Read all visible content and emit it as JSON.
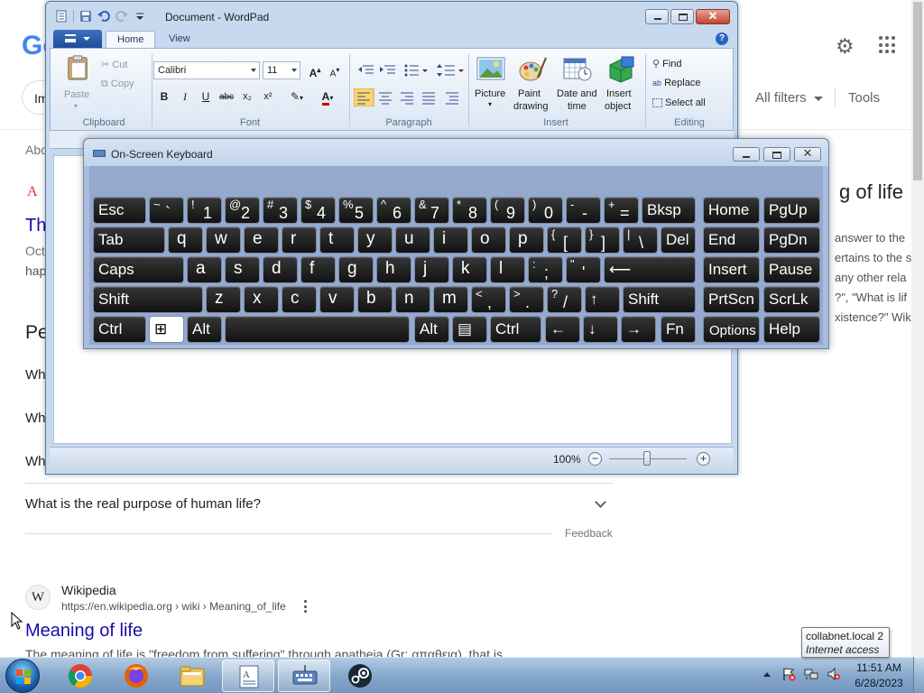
{
  "google": {
    "logo_text": "Go",
    "chip_text": "Im",
    "all_filters": "All filters",
    "tools": "Tools",
    "partial_about": "Abo",
    "partial_result_icon": "A",
    "partial_result_title": "Th",
    "partial_snippet_1": "Oct",
    "partial_snippet_2": "hap",
    "partial_people_heading": "Pe",
    "partial_q1": "Wh",
    "partial_q2": "Wh",
    "partial_q3": "Wh",
    "side_title": "g of life",
    "side_lines": [
      "answer to the",
      "ertains to the s",
      "any other rela",
      "?\", \"What is lif",
      "xistence?\" Wik"
    ],
    "faq_visible": "What is the real purpose of human life?",
    "feedback": "Feedback",
    "wiki_favicon": "W",
    "wiki_site": "Wikipedia",
    "wiki_url": "https://en.wikipedia.org › wiki › Meaning_of_life",
    "wiki_title": "Meaning of life",
    "wiki_snippet": "The meaning of life is \"freedom from suffering\" through apatheia (Gr: απαθεια), that is,"
  },
  "wordpad": {
    "title": "Document - WordPad",
    "tabs": [
      "Home",
      "View"
    ],
    "help": "?",
    "clipboard": {
      "paste": "Paste",
      "cut": "Cut",
      "copy": "Copy",
      "label": "Clipboard"
    },
    "font": {
      "family": "Calibri",
      "size": "11",
      "label": "Font",
      "bold": "B",
      "italic": "I",
      "underline": "U",
      "strike": "abc",
      "sub": "x₂",
      "sup": "x²",
      "color_letter": "A"
    },
    "paragraph": {
      "label": "Paragraph"
    },
    "insert": {
      "picture": "Picture",
      "paint_1": "Paint",
      "paint_2": "drawing",
      "date_1": "Date and",
      "date_2": "time",
      "object_1": "Insert",
      "object_2": "object",
      "label": "Insert"
    },
    "editing": {
      "find": "Find",
      "replace": "Replace",
      "select_all": "Select all",
      "label": "Editing"
    },
    "zoom": "100%"
  },
  "osk": {
    "title": "On-Screen Keyboard",
    "rows": [
      [
        {
          "label": "Esc"
        },
        {
          "sub": "~",
          "main": "`"
        },
        {
          "sub": "!",
          "main": "1"
        },
        {
          "sub": "@",
          "main": "2"
        },
        {
          "sub": "#",
          "main": "3"
        },
        {
          "sub": "$",
          "main": "4"
        },
        {
          "sub": "%",
          "main": "5"
        },
        {
          "sub": "^",
          "main": "6"
        },
        {
          "sub": "&",
          "main": "7"
        },
        {
          "sub": "*",
          "main": "8"
        },
        {
          "sub": "(",
          "main": "9"
        },
        {
          "sub": ")",
          "main": "0"
        },
        {
          "sub": "-",
          "main": "-"
        },
        {
          "sub": "+",
          "main": "="
        },
        {
          "label": "Bksp"
        },
        {
          "label": "Home"
        },
        {
          "label": "PgUp"
        }
      ],
      [
        {
          "label": "Tab"
        },
        {
          "char": "q"
        },
        {
          "char": "w"
        },
        {
          "char": "e"
        },
        {
          "char": "r"
        },
        {
          "char": "t"
        },
        {
          "char": "y"
        },
        {
          "char": "u"
        },
        {
          "char": "i"
        },
        {
          "char": "o"
        },
        {
          "char": "p"
        },
        {
          "sub": "{",
          "main": "["
        },
        {
          "sub": "}",
          "main": "]"
        },
        {
          "sub": "|",
          "main": "\\"
        },
        {
          "label": "Del"
        },
        {
          "label": "End"
        },
        {
          "label": "PgDn"
        }
      ],
      [
        {
          "label": "Caps"
        },
        {
          "char": "a"
        },
        {
          "char": "s"
        },
        {
          "char": "d"
        },
        {
          "char": "f"
        },
        {
          "char": "g"
        },
        {
          "char": "h"
        },
        {
          "char": "j"
        },
        {
          "char": "k"
        },
        {
          "char": "l"
        },
        {
          "sub": ":",
          "main": ";"
        },
        {
          "sub": "\"",
          "main": "'"
        },
        {
          "label": "⟵"
        },
        {
          "label": "Insert"
        },
        {
          "label": "Pause"
        }
      ],
      [
        {
          "label": "Shift"
        },
        {
          "char": "z"
        },
        {
          "char": "x"
        },
        {
          "char": "c"
        },
        {
          "char": "v"
        },
        {
          "char": "b"
        },
        {
          "char": "n"
        },
        {
          "char": "m"
        },
        {
          "sub": "<",
          "main": ","
        },
        {
          "sub": ">",
          "main": "."
        },
        {
          "sub": "?",
          "main": "/"
        },
        {
          "label": "↑"
        },
        {
          "label": "Shift"
        },
        {
          "label": "PrtScn"
        },
        {
          "label": "ScrLk"
        }
      ],
      [
        {
          "label": "Ctrl"
        },
        {
          "label": "⊞"
        },
        {
          "label": "Alt"
        },
        {
          "label": ""
        },
        {
          "label": "Alt"
        },
        {
          "label": "▤"
        },
        {
          "label": "Ctrl"
        },
        {
          "label": "←"
        },
        {
          "label": "↓"
        },
        {
          "label": "→"
        },
        {
          "label": "Fn"
        },
        {
          "label": "Options"
        },
        {
          "label": "Help"
        }
      ]
    ]
  },
  "taskbar": {
    "apps": [
      "chrome-icon",
      "firefox-icon",
      "explorer-icon",
      "wordpad-icon",
      "osk-icon",
      "steam-icon"
    ],
    "time": "11:51 AM",
    "date": "6/28/2023",
    "tooltip_line1": "collabnet.local  2",
    "tooltip_line2": "Internet access"
  },
  "colors": {
    "google_link": "#1a0dab",
    "key_face": "#121212",
    "osk_frame": "#a9bcdb",
    "wordpad_frame": "#c6d9ef"
  }
}
